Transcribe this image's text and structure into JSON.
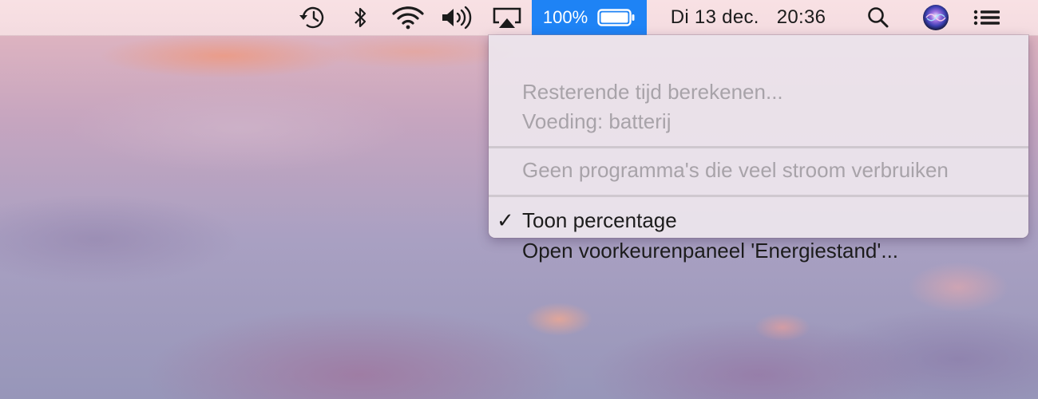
{
  "menubar": {
    "icons": {
      "time_machine": "time-machine-icon",
      "bluetooth": "bluetooth-icon",
      "wifi": "wifi-icon",
      "volume": "volume-icon",
      "airplay": "airplay-icon",
      "spotlight": "search-icon",
      "siri": "siri-icon",
      "notification_center": "list-icon"
    },
    "battery": {
      "percentage_text": "100%",
      "level": 1.0,
      "highlight_color": "#1e83f5"
    },
    "clock": {
      "date": "Di 13 dec.",
      "time": "20:36"
    }
  },
  "battery_menu": {
    "remaining_time": "Resterende tijd berekenen...",
    "power_source": "Voeding: batterij",
    "energy_apps": "Geen programma's die veel stroom verbruiken",
    "show_percentage": {
      "label": "Toon percentage",
      "checked": true,
      "check_mark": "✓"
    },
    "open_prefs": "Open voorkeurenpaneel 'Energiestand'..."
  }
}
